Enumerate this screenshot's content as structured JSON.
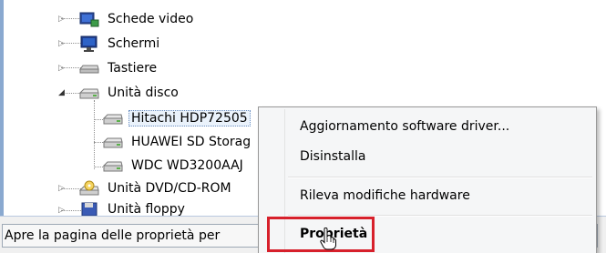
{
  "device_tree": {
    "items": [
      {
        "label": "Schede video",
        "icon": "display-adapter-icon",
        "expanded": false
      },
      {
        "label": "Schermi",
        "icon": "monitor-icon",
        "expanded": false
      },
      {
        "label": "Tastiere",
        "icon": "keyboard-icon",
        "expanded": false
      },
      {
        "label": "Unità disco",
        "icon": "disk-drive-icon",
        "expanded": true
      },
      {
        "label": "Hitachi HDP72505",
        "icon": "disk-drive-icon",
        "child": true,
        "selected": true
      },
      {
        "label": "HUAWEI SD Storag",
        "icon": "disk-drive-icon",
        "child": true
      },
      {
        "label": "WDC WD3200AAJ",
        "icon": "disk-drive-icon",
        "child": true
      },
      {
        "label": "Unità DVD/CD-ROM",
        "icon": "dvd-drive-icon",
        "expanded": false
      },
      {
        "label": "Unità floppy",
        "icon": "floppy-drive-icon",
        "expanded": false
      }
    ]
  },
  "context_menu": {
    "items": [
      {
        "label": "Aggiornamento software driver..."
      },
      {
        "label": "Disinstalla"
      },
      {
        "label": "Rileva modifiche hardware"
      },
      {
        "label": "Proprietà",
        "default": true
      }
    ]
  },
  "status_bar": {
    "text": "Apre la pagina delle proprietà per"
  },
  "colors": {
    "highlight_box": "#d7202b",
    "menu_background": "#f5f6f7",
    "window_border": "#8aa9d0"
  }
}
